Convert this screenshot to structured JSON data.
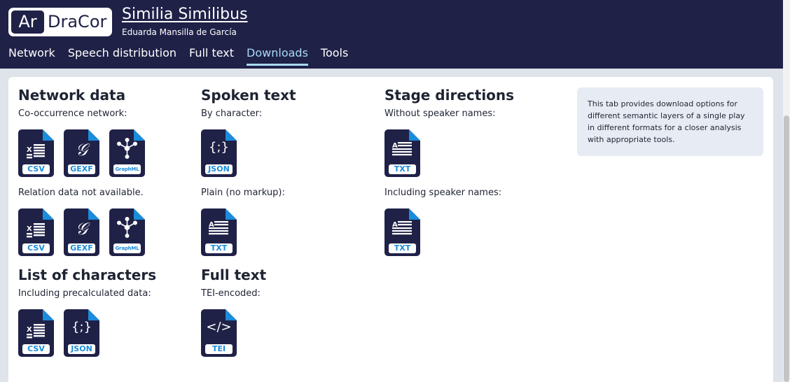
{
  "app": {
    "logo_ar": "Ar",
    "logo_rest": "DraCor"
  },
  "play": {
    "title": "Similia Similibus",
    "author": "Eduarda Mansilla de García"
  },
  "nav": {
    "tabs": [
      {
        "label": "Network",
        "active": false
      },
      {
        "label": "Speech distribution",
        "active": false
      },
      {
        "label": "Full text",
        "active": false
      },
      {
        "label": "Downloads",
        "active": true
      },
      {
        "label": "Tools",
        "active": false
      }
    ]
  },
  "sections": {
    "network": {
      "title": "Network data",
      "cooccurrence_label": "Co-occurrence network:",
      "relation_label": "Relation data not available.",
      "formats": [
        "CSV",
        "GEXF",
        "GraphML"
      ]
    },
    "spoken": {
      "title": "Spoken text",
      "by_character_label": "By character:",
      "by_character_format": "JSON",
      "plain_label": "Plain (no markup):",
      "plain_format": "TXT"
    },
    "stage": {
      "title": "Stage directions",
      "without_label": "Without speaker names:",
      "without_format": "TXT",
      "including_label": "Including speaker names:",
      "including_format": "TXT"
    },
    "characters": {
      "title": "List of characters",
      "label": "Including precalculated data:",
      "formats": [
        "CSV",
        "JSON"
      ]
    },
    "fulltext": {
      "title": "Full text",
      "label": "TEI-encoded:",
      "format": "TEI"
    }
  },
  "glyphs": {
    "json": "{;}",
    "tei": "</>",
    "xml_icon": "graphml-icon"
  },
  "info_text": "This tab provides download options for different semantic layers of a single play in different formats for a closer analysis with appropriate tools.",
  "colors": {
    "header": "#1f2147",
    "active_tab": "#a8d9f7",
    "file_icon": "#1f2147",
    "file_corner": "#1a8cdc",
    "badge_text": "#1a8cdc"
  }
}
